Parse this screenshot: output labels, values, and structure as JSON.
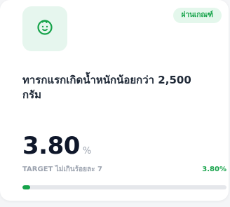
{
  "card": {
    "icon": "baby-face-icon",
    "badge_label": "ผ่านเกณฑ์",
    "title": "ทารกแรกเกิดน้ำหนักน้อยกว่า 2,500 กรัม",
    "value": "3.80",
    "unit": "%",
    "target_label": "TARGET ไม่เกินร้อยละ 7",
    "percent_label": "3.80%",
    "progress_fraction": 0.038
  },
  "colors": {
    "accent": "#16a34a",
    "icon_bg": "#e6f6ee",
    "badge_bg": "#e4f7ec"
  }
}
